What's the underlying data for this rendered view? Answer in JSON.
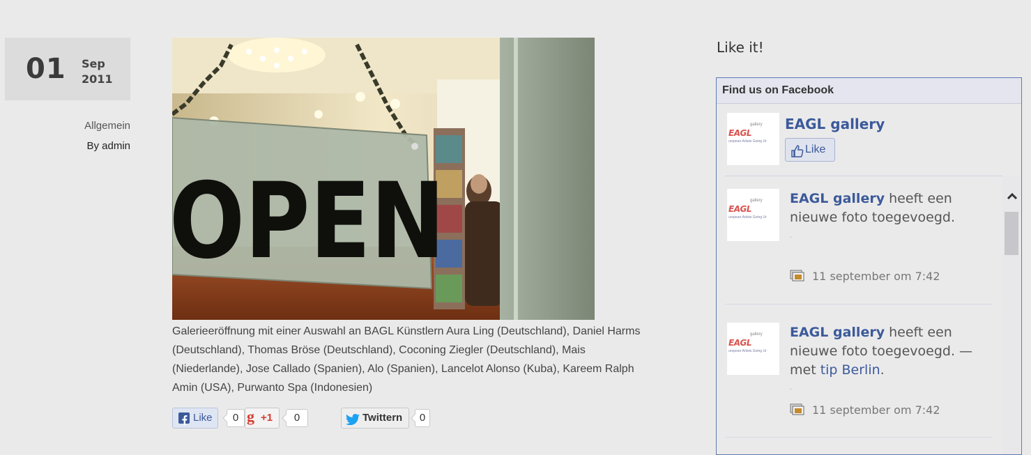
{
  "post": {
    "date_day": "01",
    "date_month": "Sep",
    "date_year": "2011",
    "category": "Allgemein",
    "author": "By admin",
    "image_sign_text": "OPEN",
    "caption": "Galerieeröffnung mit einer Auswahl an BAGL Künstlern Aura Ling (Deutschland), Daniel Harms (Deutschland), Thomas Bröse (Deutschland), Coconing Ziegler (Deutschland), Mais (Niederlande), Jose Callado (Spanien), Alo (Spanien), Lancelot Alonso (Kuba), Kareem Ralph Amin (USA), Purwanto Spa (Indonesien)"
  },
  "social": {
    "fb_label": "Like",
    "fb_count": "0",
    "gplus_label": "+1",
    "gplus_count": "0",
    "twitter_label": "Twittern",
    "twitter_count": "0"
  },
  "sidebar": {
    "like_heading": "Like it!",
    "fb_box_title": "Find us on Facebook",
    "page_name": "EAGL gallery",
    "page_like_label": "Like",
    "logo_text": "EAGL",
    "logo_sub": "gallery",
    "logo_line": "uropean Artists Going Ur",
    "posts": [
      {
        "name": "EAGL gallery",
        "text": " heeft een nieuwe foto toegevoegd.",
        "dot": ".",
        "time": "11 september om 7:42"
      },
      {
        "name": "EAGL gallery",
        "text": " heeft een nieuwe foto toegevoegd. — met ",
        "link": "tip Berlin",
        "end": ".",
        "dot": ".",
        "time": "11 september om 7:42"
      }
    ]
  },
  "colors": {
    "facebook_blue": "#3b5a9a",
    "background": "#ebeaeb",
    "twitter_blue": "#1da1f2",
    "gplus_red": "#d73d32"
  }
}
